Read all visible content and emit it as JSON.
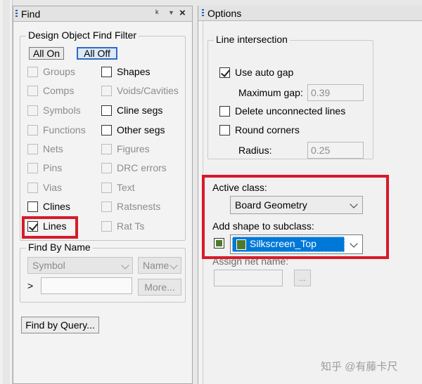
{
  "find_panel": {
    "title": "Find",
    "header_icons": [
      "pin-icon",
      "dropdown-icon",
      "close-icon"
    ],
    "filter_group": {
      "title": "Design Object Find Filter",
      "all_on": "All On",
      "all_off": "All Off",
      "left_items": [
        {
          "label": "Groups",
          "checked": false,
          "enabled": false
        },
        {
          "label": "Comps",
          "checked": false,
          "enabled": false
        },
        {
          "label": "Symbols",
          "checked": false,
          "enabled": false
        },
        {
          "label": "Functions",
          "checked": false,
          "enabled": false
        },
        {
          "label": "Nets",
          "checked": false,
          "enabled": false
        },
        {
          "label": "Pins",
          "checked": false,
          "enabled": false
        },
        {
          "label": "Vias",
          "checked": false,
          "enabled": false
        },
        {
          "label": "Clines",
          "checked": false,
          "enabled": true
        },
        {
          "label": "Lines",
          "checked": true,
          "enabled": true
        }
      ],
      "right_items": [
        {
          "label": "Shapes",
          "checked": false,
          "enabled": true
        },
        {
          "label": "Voids/Cavities",
          "checked": false,
          "enabled": false
        },
        {
          "label": "Cline segs",
          "checked": false,
          "enabled": true
        },
        {
          "label": "Other segs",
          "checked": false,
          "enabled": true
        },
        {
          "label": "Figures",
          "checked": false,
          "enabled": false
        },
        {
          "label": "DRC errors",
          "checked": false,
          "enabled": false
        },
        {
          "label": "Text",
          "checked": false,
          "enabled": false
        },
        {
          "label": "Ratsnests",
          "checked": false,
          "enabled": false
        },
        {
          "label": "Rat Ts",
          "checked": false,
          "enabled": false
        }
      ]
    },
    "find_by_name": {
      "title": "Find By Name",
      "type_value": "Symbol",
      "mode_value": "Name",
      "prompt": ">",
      "input_value": "",
      "more_label": "More..."
    },
    "find_by_query_label": "Find by Query..."
  },
  "options_panel": {
    "title": "Options",
    "line_intersection": {
      "title": "Line intersection",
      "use_auto_gap": {
        "label": "Use auto gap",
        "checked": true
      },
      "max_gap_label": "Maximum gap:",
      "max_gap_value": "0.39",
      "delete_unconnected": {
        "label": "Delete unconnected lines",
        "checked": false
      },
      "round_corners": {
        "label": "Round corners",
        "checked": false
      },
      "radius_label": "Radius:",
      "radius_value": "0.25"
    },
    "active_class_label": "Active class:",
    "active_class_value": "Board Geometry",
    "subclass_label": "Add shape to subclass:",
    "subclass_value": "Silkscreen_Top",
    "subclass_color": "#4f7a28",
    "assign_net_label": "Assign net name:",
    "assign_net_value": "",
    "browse_label": "..."
  },
  "watermark": "知乎 @有藤卡尺",
  "colors": {
    "highlight": "#d71a2a",
    "selection": "#0078d7"
  }
}
